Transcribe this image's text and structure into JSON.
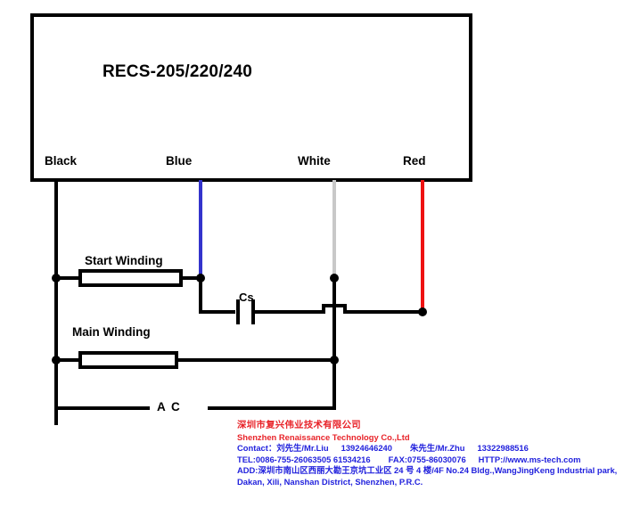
{
  "diagram": {
    "module_title": "RECS-205/220/240",
    "terminals": [
      {
        "name": "black-terminal",
        "label": "Black",
        "wire_color": "#000000"
      },
      {
        "name": "blue-terminal",
        "label": "Blue",
        "wire_color": "#3333cc"
      },
      {
        "name": "white-terminal",
        "label": "White",
        "wire_color": "#c8c8c8"
      },
      {
        "name": "red-terminal",
        "label": "Red",
        "wire_color": "#ee1111"
      }
    ],
    "components": [
      {
        "name": "start-winding",
        "label": "Start Winding"
      },
      {
        "name": "main-winding",
        "label": "Main Winding"
      },
      {
        "name": "capacitor",
        "label": "Cs"
      },
      {
        "name": "ac-supply",
        "label": "A C"
      }
    ],
    "colors": {
      "wire_black": "#000000",
      "wire_blue": "#3333cc",
      "wire_white": "#c8c8c8",
      "wire_red": "#ee1111",
      "enclosure_border": "#000000",
      "background": "#ffffff"
    }
  },
  "footer": {
    "company_cn": "深圳市复兴伟业技术有限公司",
    "company_en": "Shenzhen Renaissance Technology Co.,Ltd",
    "contact_prefix": "Contact：",
    "contact_name_1": "刘先生/Mr.Liu",
    "contact_phone_1": "13924646240",
    "contact_name_2": "朱先生/Mr.Zhu",
    "contact_phone_2": "13322988516",
    "tel": "TEL:0086-755-26063505 61534216",
    "fax": "FAX:0755-86030076",
    "http": "HTTP://www.ms-tech.com",
    "address_prefix": "ADD:",
    "address_cn": "深圳市南山区西丽大勘王京坑工业区 24 号 4 楼/4F No.24 Bldg.,WangJingKeng Industrial park,",
    "address_en": "Dakan, Xili, Nanshan District, Shenzhen, P.R.C.",
    "colors": {
      "company": "#e8242a",
      "detail": "#2222dd"
    }
  }
}
